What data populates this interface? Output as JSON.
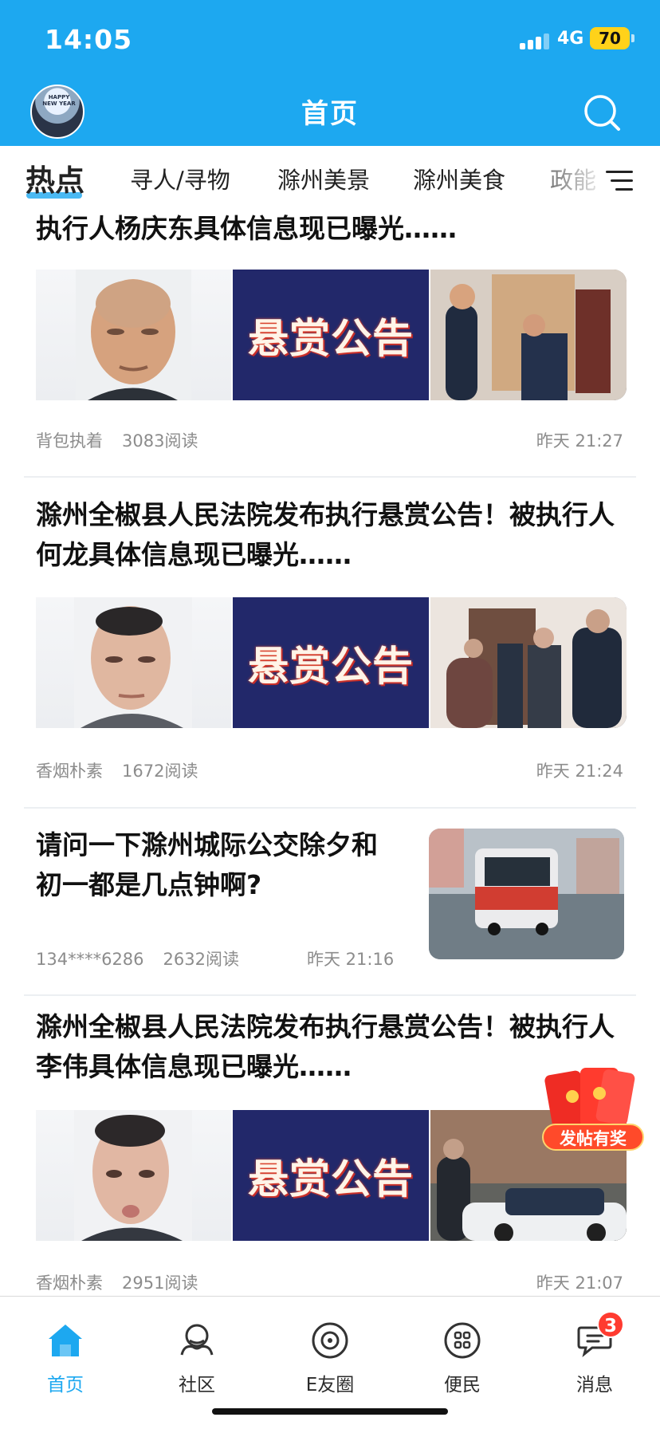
{
  "status": {
    "time": "14:05",
    "network": "4G",
    "battery": "70"
  },
  "header": {
    "title": "首页",
    "avatar_text": "HAPPY NEW YEAR"
  },
  "tabs": [
    {
      "label": "热点",
      "active": true
    },
    {
      "label": "寻人/寻物",
      "active": false
    },
    {
      "label": "滁州美景",
      "active": false
    },
    {
      "label": "滁州美食",
      "active": false
    },
    {
      "label": "政能",
      "active": false
    }
  ],
  "feed": {
    "articles": [
      {
        "title": "执行人杨庆东具体信息现已曝光……",
        "reward_text": "悬赏公告",
        "author": "背包执着",
        "reads": "3083阅读",
        "time": "昨天 21:27"
      },
      {
        "title": "滁州全椒县人民法院发布执行悬赏公告！被执行人何龙具体信息现已曝光……",
        "reward_text": "悬赏公告",
        "author": "香烟朴素",
        "reads": "1672阅读",
        "time": "昨天 21:24"
      },
      {
        "title": "请问一下滁州城际公交除夕和初一都是几点钟啊?",
        "author": "134****6286",
        "reads": "2632阅读",
        "time": "昨天 21:16"
      },
      {
        "title": "滁州全椒县人民法院发布执行悬赏公告！被执行人李伟具体信息现已曝光……",
        "reward_text": "悬赏公告",
        "author": "香烟朴素",
        "reads": "2951阅读",
        "time": "昨天 21:07"
      }
    ]
  },
  "red_packet": {
    "label": "发帖有奖"
  },
  "bottom_nav": [
    {
      "label": "首页",
      "icon": "home-icon",
      "active": true
    },
    {
      "label": "社区",
      "icon": "community-icon",
      "active": false
    },
    {
      "label": "E友圈",
      "icon": "friends-icon",
      "active": false
    },
    {
      "label": "便民",
      "icon": "services-icon",
      "active": false
    },
    {
      "label": "消息",
      "icon": "message-icon",
      "active": false,
      "badge": "3"
    }
  ],
  "colors": {
    "accent": "#1da8f0",
    "badge": "#ff3b30",
    "reward": "#22286a"
  }
}
